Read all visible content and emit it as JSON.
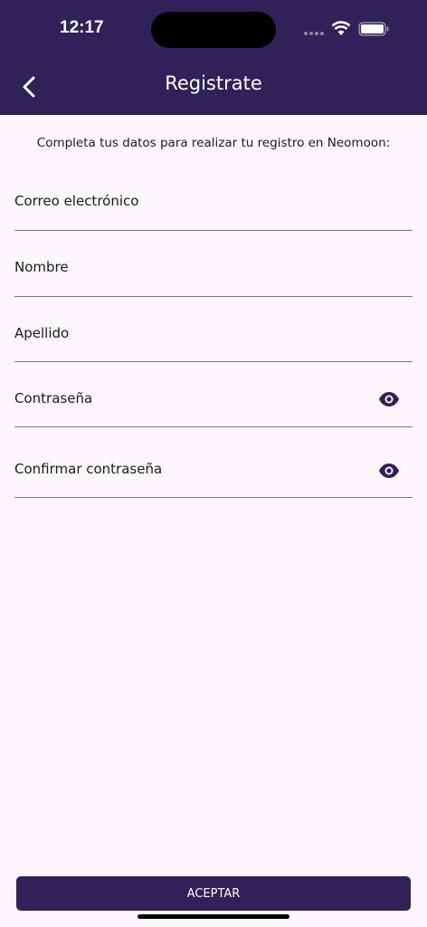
{
  "status_bar": {
    "time": "12:17",
    "icons": [
      "signal-dots-icon",
      "wifi-icon",
      "battery-icon"
    ]
  },
  "header": {
    "title": "Registrate",
    "back_icon": "chevron-left-icon"
  },
  "intro_text": "Completa tus datos para realizar tu registro en Neomoon:",
  "form": {
    "fields": [
      {
        "label": "Correo electrónico"
      },
      {
        "label": "Nombre"
      },
      {
        "label": "Apellido"
      },
      {
        "label": "Contraseña",
        "icon": "eye-icon"
      },
      {
        "label": "Confirmar contraseña",
        "icon": "eye-icon"
      }
    ]
  },
  "accept_button": {
    "label": "ACEPTAR"
  },
  "colors": {
    "primary": "#2e2258",
    "background": "#fcf7fc"
  }
}
